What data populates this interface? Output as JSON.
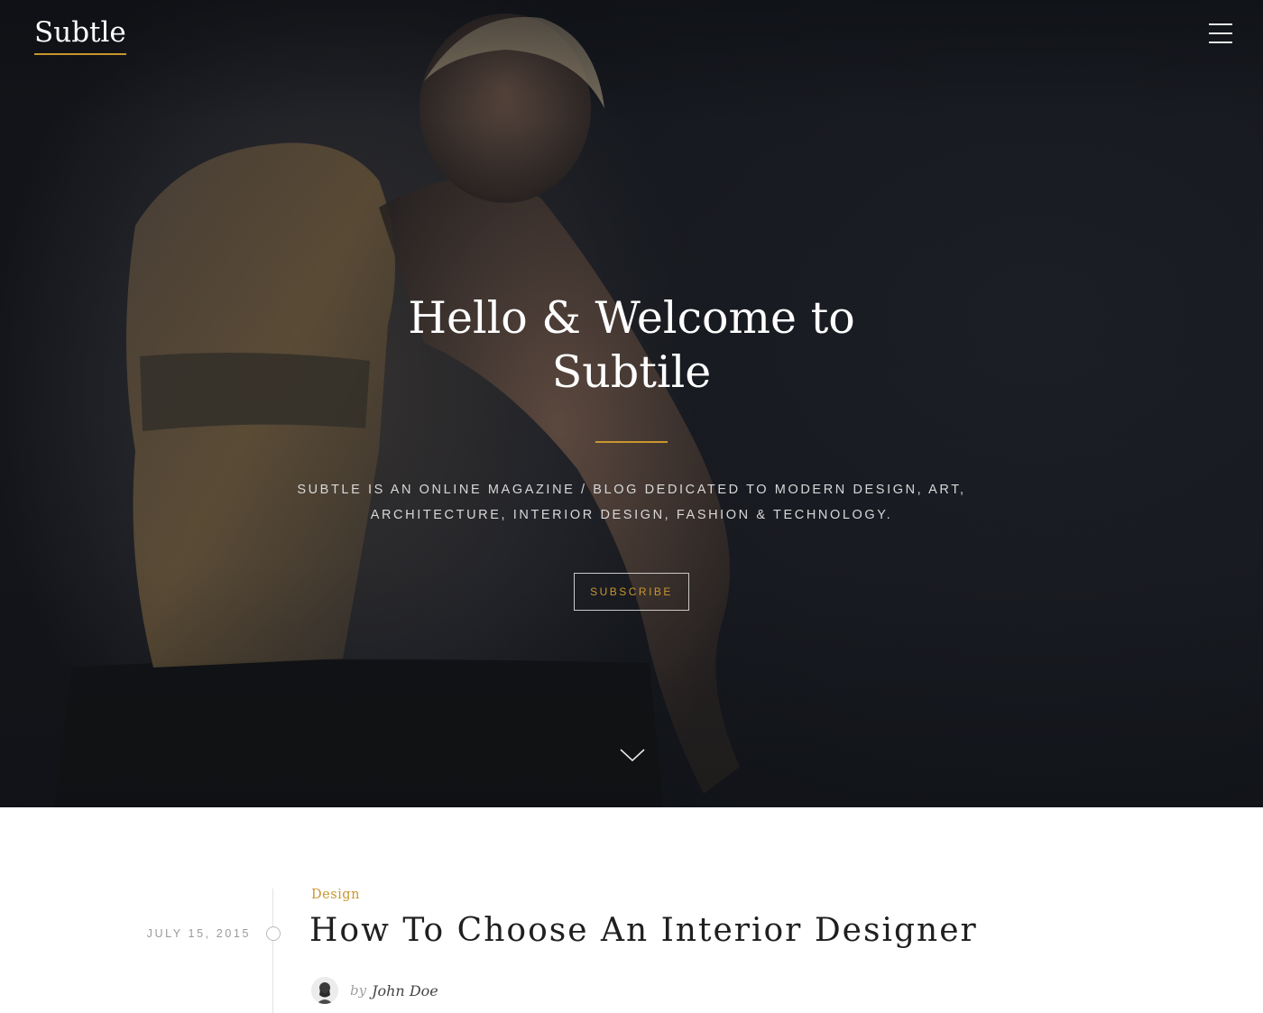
{
  "header": {
    "logo": "Subtle",
    "menu_icon": "hamburger-menu-icon"
  },
  "hero": {
    "title_line1": "Hello & Welcome to",
    "title_line2": "Subtile",
    "subtitle_line1": "Subtle is an online magazine / blog dedicated to modern design, art,",
    "subtitle_line2": "architecture, interior design, fashion & technology.",
    "subscribe_label": "SUBSCRIBE",
    "scroll_icon": "chevron-down-icon"
  },
  "post": {
    "date": "JULY 15, 2015",
    "category": "Design",
    "title": "How To Choose An Interior Designer",
    "author_prefix": "by",
    "author_name": "John Doe"
  },
  "colors": {
    "accent": "#c9962e",
    "hero_bg": "#181a1f",
    "text_dark": "#1f1f1f"
  }
}
